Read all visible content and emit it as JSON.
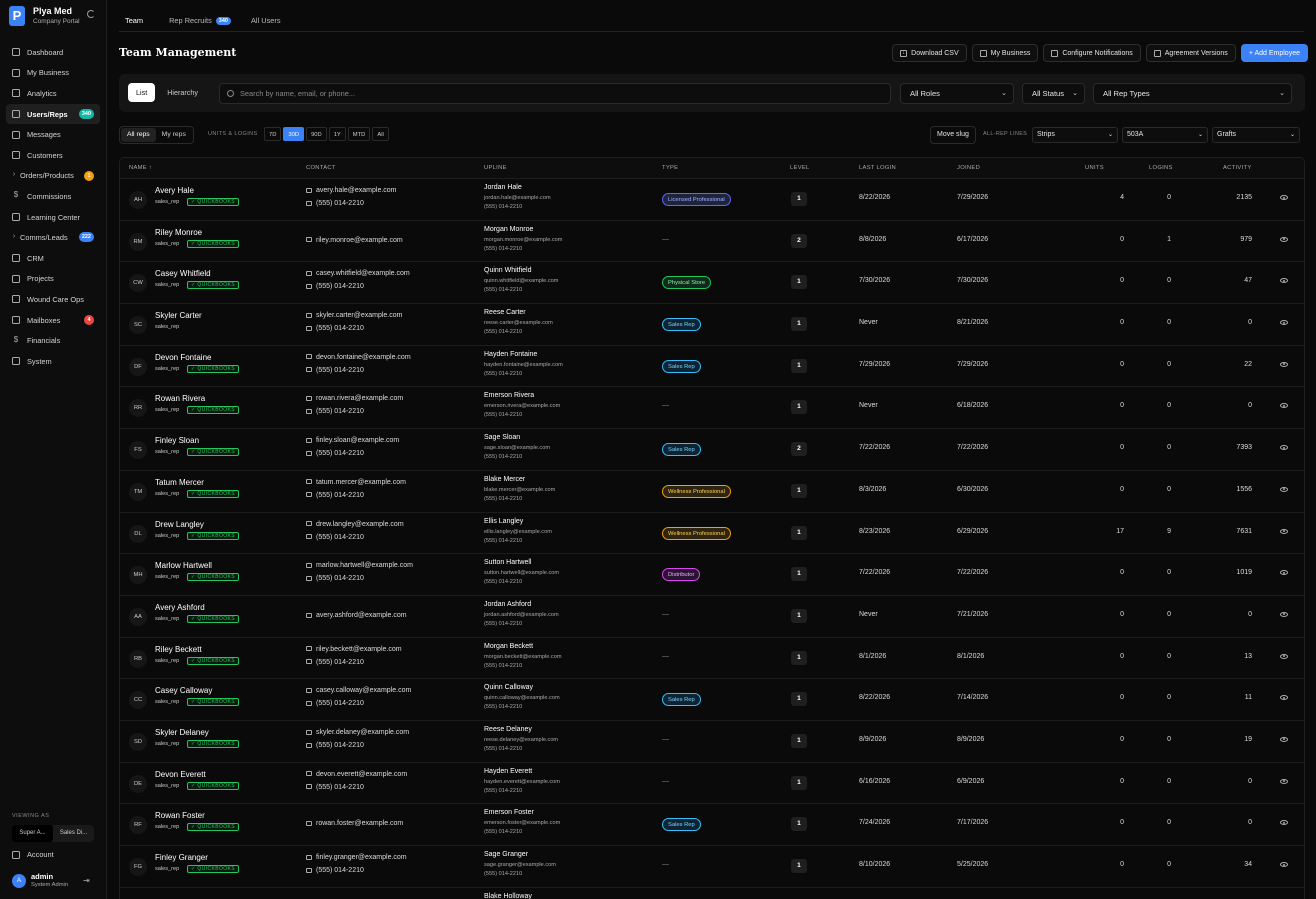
{
  "brand": {
    "name": "Plya Med",
    "subtitle": "Company Portal",
    "logo": "P"
  },
  "nav": [
    {
      "label": "Dashboard",
      "icon": "dashboard-icon"
    },
    {
      "label": "My Business",
      "icon": "business-icon"
    },
    {
      "label": "Analytics",
      "icon": "analytics-icon"
    },
    {
      "label": "Users/Reps",
      "icon": "users-icon",
      "badge": "340",
      "badge_color": "teal",
      "active": true
    },
    {
      "label": "Messages",
      "icon": "message-icon"
    },
    {
      "label": "Customers",
      "icon": "customers-icon"
    },
    {
      "label": "Orders/Products",
      "icon": "chevron-right-icon",
      "badge": "1",
      "badge_color": "amber"
    },
    {
      "label": "Commissions",
      "icon": "dollar-icon"
    },
    {
      "label": "Learning Center",
      "icon": "graduation-icon"
    },
    {
      "label": "Comms/Leads",
      "icon": "chevron-right-icon",
      "badge": "222",
      "badge_color": "blue"
    },
    {
      "label": "CRM",
      "icon": "crm-icon"
    },
    {
      "label": "Projects",
      "icon": "folder-icon"
    },
    {
      "label": "Wound Care Ops",
      "icon": "pulse-icon"
    },
    {
      "label": "Mailboxes",
      "icon": "mailbox-icon",
      "badge": "4",
      "badge_color": "red"
    },
    {
      "label": "Financials",
      "icon": "dollar-icon"
    },
    {
      "label": "System",
      "icon": "gear-icon"
    }
  ],
  "viewing_as": {
    "label": "VIEWING AS",
    "roles": [
      "Super A...",
      "Sales Di..."
    ]
  },
  "account": {
    "label": "Account",
    "user": "admin",
    "user_role": "System Admin",
    "avatar": "A"
  },
  "tabs": [
    {
      "label": "Team",
      "active": true
    },
    {
      "label": "Rep Recruits",
      "badge": "340"
    },
    {
      "label": "All Users"
    }
  ],
  "page_title": "Team Management",
  "actions": {
    "download": "Download CSV",
    "business": "My Business",
    "notifications": "Configure Notifications",
    "agreements": "Agreement Versions",
    "add": "+ Add Employee"
  },
  "filters": {
    "view_list": "List",
    "view_hierarchy": "Hierarchy",
    "search_placeholder": "Search by name, email, or phone...",
    "roles": "All Roles",
    "status": "All Status",
    "rep_types": "All Rep Types"
  },
  "toolbar": {
    "all_reps": "All reps",
    "my_reps": "My reps",
    "units_label": "UNITS & LOGINS",
    "ranges": [
      "7D",
      "30D",
      "90D",
      "1Y",
      "MTD",
      "All"
    ],
    "selected_range": "30D",
    "move_slug": "Move slug",
    "all_rep_lines": "ALL-REP LINES",
    "line_a": "Strips",
    "line_b": "503A",
    "line_c": "Grafts"
  },
  "columns": {
    "name": "NAME ↑",
    "contact": "CONTACT",
    "upline": "UPLINE",
    "type": "TYPE",
    "level": "LEVEL",
    "last_login": "LAST LOGIN",
    "joined": "JOINED",
    "units": "UNITS",
    "logins": "LOGINS",
    "activity": "ACTIVITY"
  },
  "rows": [
    {
      "initials": "AH",
      "name": "Avery Hale",
      "role": "sales_rep",
      "qb": true,
      "email": "avery.hale@example.com",
      "phone": "(555) 014-2210",
      "up_name": "Jordan Hale",
      "up_email": "jordan.hale@example.com",
      "up_phone": "(555) 014-2210",
      "type": "Licensed Professional",
      "type_class": "t-lic",
      "level": "1",
      "last_login": "8/22/2026",
      "joined": "7/29/2026",
      "units": "4",
      "logins": "0",
      "activity": "2135"
    },
    {
      "initials": "RM",
      "name": "Riley Monroe",
      "role": "sales_rep",
      "qb": true,
      "email": "riley.monroe@example.com",
      "phone": "",
      "up_name": "Morgan Monroe",
      "up_email": "morgan.monroe@example.com",
      "up_phone": "(555) 014-2210",
      "type": "",
      "type_class": "",
      "level": "2",
      "last_login": "8/8/2026",
      "joined": "6/17/2026",
      "units": "0",
      "logins": "1",
      "activity": "979"
    },
    {
      "initials": "CW",
      "name": "Casey Whitfield",
      "role": "sales_rep",
      "qb": true,
      "email": "casey.whitfield@example.com",
      "phone": "(555) 014-2210",
      "up_name": "Quinn Whitfield",
      "up_email": "quinn.whitfield@example.com",
      "up_phone": "(555) 014-2210",
      "type": "Physical Store",
      "type_class": "t-phy",
      "level": "1",
      "last_login": "7/30/2026",
      "joined": "7/30/2026",
      "units": "0",
      "logins": "0",
      "activity": "47"
    },
    {
      "initials": "SC",
      "name": "Skyler Carter",
      "role": "sales_rep",
      "qb": false,
      "email": "skyler.carter@example.com",
      "phone": "(555) 014-2210",
      "up_name": "Reese Carter",
      "up_email": "reese.carter@example.com",
      "up_phone": "(555) 014-2210",
      "type": "Sales Rep",
      "type_class": "t-sr",
      "level": "1",
      "last_login": "Never",
      "joined": "8/21/2026",
      "units": "0",
      "logins": "0",
      "activity": "0"
    },
    {
      "initials": "DF",
      "name": "Devon Fontaine",
      "role": "sales_rep",
      "qb": true,
      "email": "devon.fontaine@example.com",
      "phone": "(555) 014-2210",
      "up_name": "Hayden Fontaine",
      "up_email": "hayden.fontaine@example.com",
      "up_phone": "(555) 014-2210",
      "type": "Sales Rep",
      "type_class": "t-sr",
      "level": "1",
      "last_login": "7/29/2026",
      "joined": "7/29/2026",
      "units": "0",
      "logins": "0",
      "activity": "22"
    },
    {
      "initials": "RR",
      "name": "Rowan Rivera",
      "role": "sales_rep",
      "qb": true,
      "email": "rowan.rivera@example.com",
      "phone": "(555) 014-2210",
      "up_name": "Emerson Rivera",
      "up_email": "emerson.rivera@example.com",
      "up_phone": "(555) 014-2210",
      "type": "",
      "type_class": "",
      "level": "1",
      "last_login": "Never",
      "joined": "6/18/2026",
      "units": "0",
      "logins": "0",
      "activity": "0"
    },
    {
      "initials": "FS",
      "name": "Finley Sloan",
      "role": "sales_rep",
      "qb": true,
      "email": "finley.sloan@example.com",
      "phone": "(555) 014-2210",
      "up_name": "Sage Sloan",
      "up_email": "sage.sloan@example.com",
      "up_phone": "(555) 014-2210",
      "type": "Sales Rep",
      "type_class": "t-sr",
      "level": "2",
      "last_login": "7/22/2026",
      "joined": "7/22/2026",
      "units": "0",
      "logins": "0",
      "activity": "7393"
    },
    {
      "initials": "TM",
      "name": "Tatum Mercer",
      "role": "sales_rep",
      "qb": true,
      "email": "tatum.mercer@example.com",
      "phone": "(555) 014-2210",
      "up_name": "Blake Mercer",
      "up_email": "blake.mercer@example.com",
      "up_phone": "(555) 014-2210",
      "type": "Wellness Professional",
      "type_class": "t-wel",
      "level": "1",
      "last_login": "8/3/2026",
      "joined": "6/30/2026",
      "units": "0",
      "logins": "0",
      "activity": "1556"
    },
    {
      "initials": "DL",
      "name": "Drew Langley",
      "role": "sales_rep",
      "qb": true,
      "email": "drew.langley@example.com",
      "phone": "(555) 014-2210",
      "up_name": "Ellis Langley",
      "up_email": "ellis.langley@example.com",
      "up_phone": "(555) 014-2210",
      "type": "Wellness Professional",
      "type_class": "t-wel",
      "level": "1",
      "last_login": "8/23/2026",
      "joined": "6/29/2026",
      "units": "17",
      "logins": "9",
      "activity": "7631"
    },
    {
      "initials": "MH",
      "name": "Marlow Hartwell",
      "role": "sales_rep",
      "qb": true,
      "email": "marlow.hartwell@example.com",
      "phone": "(555) 014-2210",
      "up_name": "Sutton Hartwell",
      "up_email": "sutton.hartwell@example.com",
      "up_phone": "(555) 014-2210",
      "type": "Distributor",
      "type_class": "t-dis",
      "level": "1",
      "last_login": "7/22/2026",
      "joined": "7/22/2026",
      "units": "0",
      "logins": "0",
      "activity": "1019"
    },
    {
      "initials": "AA",
      "name": "Avery Ashford",
      "role": "sales_rep",
      "qb": true,
      "email": "avery.ashford@example.com",
      "phone": "",
      "up_name": "Jordan Ashford",
      "up_email": "jordan.ashford@example.com",
      "up_phone": "(555) 014-2210",
      "type": "",
      "type_class": "",
      "level": "1",
      "last_login": "Never",
      "joined": "7/21/2026",
      "units": "0",
      "logins": "0",
      "activity": "0"
    },
    {
      "initials": "RB",
      "name": "Riley Beckett",
      "role": "sales_rep",
      "qb": true,
      "email": "riley.beckett@example.com",
      "phone": "(555) 014-2210",
      "up_name": "Morgan Beckett",
      "up_email": "morgan.beckett@example.com",
      "up_phone": "(555) 014-2210",
      "type": "",
      "type_class": "",
      "level": "1",
      "last_login": "8/1/2026",
      "joined": "8/1/2026",
      "units": "0",
      "logins": "0",
      "activity": "13"
    },
    {
      "initials": "CC",
      "name": "Casey Calloway",
      "role": "sales_rep",
      "qb": true,
      "email": "casey.calloway@example.com",
      "phone": "(555) 014-2210",
      "up_name": "Quinn Calloway",
      "up_email": "quinn.calloway@example.com",
      "up_phone": "(555) 014-2210",
      "type": "Sales Rep",
      "type_class": "t-sr",
      "level": "1",
      "last_login": "8/22/2026",
      "joined": "7/14/2026",
      "units": "0",
      "logins": "0",
      "activity": "11"
    },
    {
      "initials": "SD",
      "name": "Skyler Delaney",
      "role": "sales_rep",
      "qb": true,
      "email": "skyler.delaney@example.com",
      "phone": "(555) 014-2210",
      "up_name": "Reese Delaney",
      "up_email": "reese.delaney@example.com",
      "up_phone": "(555) 014-2210",
      "type": "",
      "type_class": "",
      "level": "1",
      "last_login": "8/9/2026",
      "joined": "8/9/2026",
      "units": "0",
      "logins": "0",
      "activity": "19"
    },
    {
      "initials": "DE",
      "name": "Devon Everett",
      "role": "sales_rep",
      "qb": true,
      "email": "devon.everett@example.com",
      "phone": "(555) 014-2210",
      "up_name": "Hayden Everett",
      "up_email": "hayden.everett@example.com",
      "up_phone": "(555) 014-2210",
      "type": "",
      "type_class": "",
      "level": "1",
      "last_login": "6/16/2026",
      "joined": "6/9/2026",
      "units": "0",
      "logins": "0",
      "activity": "0"
    },
    {
      "initials": "RF",
      "name": "Rowan Foster",
      "role": "sales_rep",
      "qb": true,
      "email": "rowan.foster@example.com",
      "phone": "",
      "up_name": "Emerson Foster",
      "up_email": "emerson.foster@example.com",
      "up_phone": "(555) 014-2210",
      "type": "Sales Rep",
      "type_class": "t-sr",
      "level": "1",
      "last_login": "7/24/2026",
      "joined": "7/17/2026",
      "units": "0",
      "logins": "0",
      "activity": "0"
    },
    {
      "initials": "FG",
      "name": "Finley Granger",
      "role": "sales_rep",
      "qb": true,
      "email": "finley.granger@example.com",
      "phone": "(555) 014-2210",
      "up_name": "Sage Granger",
      "up_email": "sage.granger@example.com",
      "up_phone": "(555) 014-2210",
      "type": "",
      "type_class": "",
      "level": "1",
      "last_login": "8/10/2026",
      "joined": "5/25/2026",
      "units": "0",
      "logins": "0",
      "activity": "34"
    },
    {
      "initials": "",
      "name": "",
      "role": "",
      "qb": false,
      "email": "",
      "phone": "",
      "up_name": "Blake Holloway",
      "up_email": "",
      "up_phone": "",
      "type": "",
      "type_class": "",
      "level": "",
      "last_login": "",
      "joined": "",
      "units": "",
      "logins": "",
      "activity": ""
    }
  ],
  "labels": {
    "quickbooks": "✓ QUICKBOOKS",
    "dash": "—"
  }
}
